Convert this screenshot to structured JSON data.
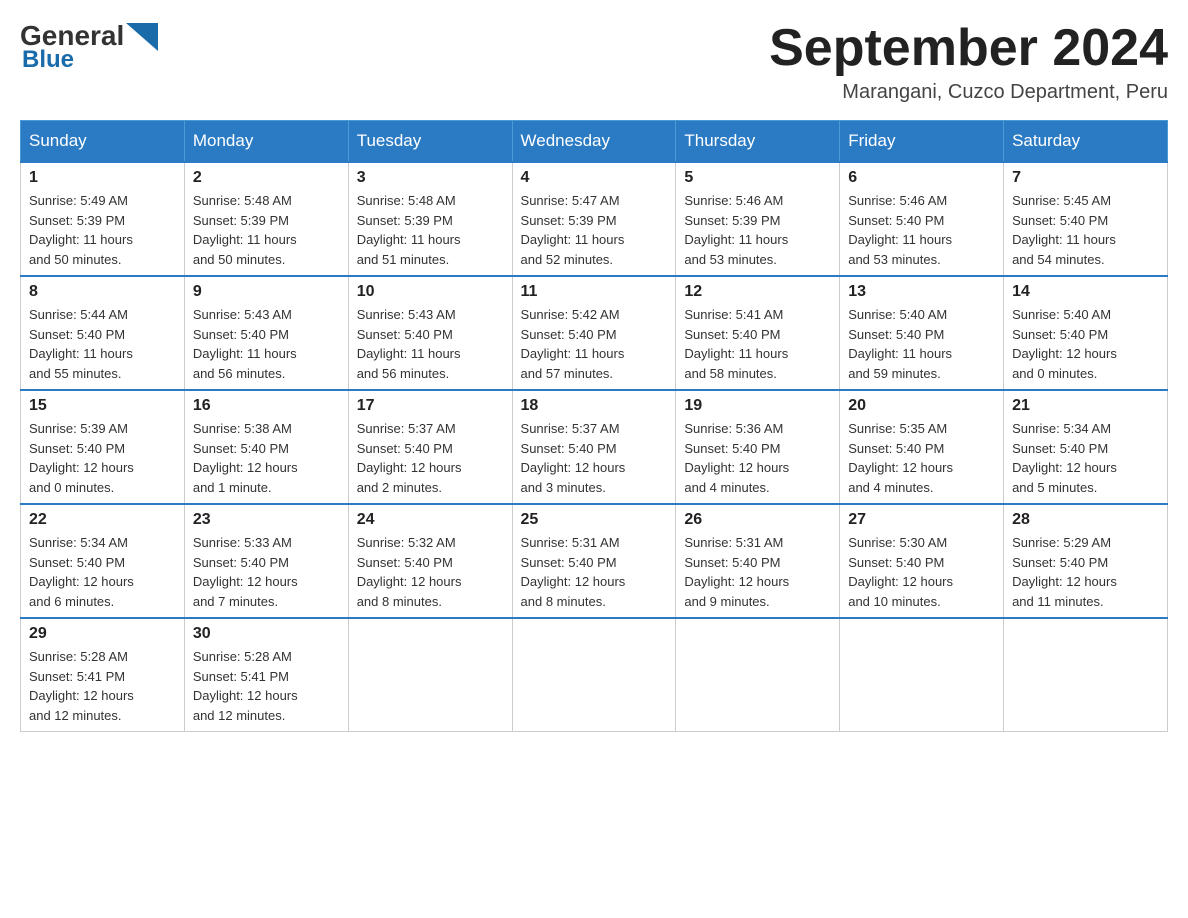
{
  "header": {
    "logo_general": "General",
    "logo_blue": "Blue",
    "month_title": "September 2024",
    "location": "Marangani, Cuzco Department, Peru"
  },
  "days_of_week": [
    "Sunday",
    "Monday",
    "Tuesday",
    "Wednesday",
    "Thursday",
    "Friday",
    "Saturday"
  ],
  "weeks": [
    [
      {
        "day": "1",
        "sunrise": "5:49 AM",
        "sunset": "5:39 PM",
        "daylight": "11 hours and 50 minutes."
      },
      {
        "day": "2",
        "sunrise": "5:48 AM",
        "sunset": "5:39 PM",
        "daylight": "11 hours and 50 minutes."
      },
      {
        "day": "3",
        "sunrise": "5:48 AM",
        "sunset": "5:39 PM",
        "daylight": "11 hours and 51 minutes."
      },
      {
        "day": "4",
        "sunrise": "5:47 AM",
        "sunset": "5:39 PM",
        "daylight": "11 hours and 52 minutes."
      },
      {
        "day": "5",
        "sunrise": "5:46 AM",
        "sunset": "5:39 PM",
        "daylight": "11 hours and 53 minutes."
      },
      {
        "day": "6",
        "sunrise": "5:46 AM",
        "sunset": "5:40 PM",
        "daylight": "11 hours and 53 minutes."
      },
      {
        "day": "7",
        "sunrise": "5:45 AM",
        "sunset": "5:40 PM",
        "daylight": "11 hours and 54 minutes."
      }
    ],
    [
      {
        "day": "8",
        "sunrise": "5:44 AM",
        "sunset": "5:40 PM",
        "daylight": "11 hours and 55 minutes."
      },
      {
        "day": "9",
        "sunrise": "5:43 AM",
        "sunset": "5:40 PM",
        "daylight": "11 hours and 56 minutes."
      },
      {
        "day": "10",
        "sunrise": "5:43 AM",
        "sunset": "5:40 PM",
        "daylight": "11 hours and 56 minutes."
      },
      {
        "day": "11",
        "sunrise": "5:42 AM",
        "sunset": "5:40 PM",
        "daylight": "11 hours and 57 minutes."
      },
      {
        "day": "12",
        "sunrise": "5:41 AM",
        "sunset": "5:40 PM",
        "daylight": "11 hours and 58 minutes."
      },
      {
        "day": "13",
        "sunrise": "5:40 AM",
        "sunset": "5:40 PM",
        "daylight": "11 hours and 59 minutes."
      },
      {
        "day": "14",
        "sunrise": "5:40 AM",
        "sunset": "5:40 PM",
        "daylight": "12 hours and 0 minutes."
      }
    ],
    [
      {
        "day": "15",
        "sunrise": "5:39 AM",
        "sunset": "5:40 PM",
        "daylight": "12 hours and 0 minutes."
      },
      {
        "day": "16",
        "sunrise": "5:38 AM",
        "sunset": "5:40 PM",
        "daylight": "12 hours and 1 minute."
      },
      {
        "day": "17",
        "sunrise": "5:37 AM",
        "sunset": "5:40 PM",
        "daylight": "12 hours and 2 minutes."
      },
      {
        "day": "18",
        "sunrise": "5:37 AM",
        "sunset": "5:40 PM",
        "daylight": "12 hours and 3 minutes."
      },
      {
        "day": "19",
        "sunrise": "5:36 AM",
        "sunset": "5:40 PM",
        "daylight": "12 hours and 4 minutes."
      },
      {
        "day": "20",
        "sunrise": "5:35 AM",
        "sunset": "5:40 PM",
        "daylight": "12 hours and 4 minutes."
      },
      {
        "day": "21",
        "sunrise": "5:34 AM",
        "sunset": "5:40 PM",
        "daylight": "12 hours and 5 minutes."
      }
    ],
    [
      {
        "day": "22",
        "sunrise": "5:34 AM",
        "sunset": "5:40 PM",
        "daylight": "12 hours and 6 minutes."
      },
      {
        "day": "23",
        "sunrise": "5:33 AM",
        "sunset": "5:40 PM",
        "daylight": "12 hours and 7 minutes."
      },
      {
        "day": "24",
        "sunrise": "5:32 AM",
        "sunset": "5:40 PM",
        "daylight": "12 hours and 8 minutes."
      },
      {
        "day": "25",
        "sunrise": "5:31 AM",
        "sunset": "5:40 PM",
        "daylight": "12 hours and 8 minutes."
      },
      {
        "day": "26",
        "sunrise": "5:31 AM",
        "sunset": "5:40 PM",
        "daylight": "12 hours and 9 minutes."
      },
      {
        "day": "27",
        "sunrise": "5:30 AM",
        "sunset": "5:40 PM",
        "daylight": "12 hours and 10 minutes."
      },
      {
        "day": "28",
        "sunrise": "5:29 AM",
        "sunset": "5:40 PM",
        "daylight": "12 hours and 11 minutes."
      }
    ],
    [
      {
        "day": "29",
        "sunrise": "5:28 AM",
        "sunset": "5:41 PM",
        "daylight": "12 hours and 12 minutes."
      },
      {
        "day": "30",
        "sunrise": "5:28 AM",
        "sunset": "5:41 PM",
        "daylight": "12 hours and 12 minutes."
      },
      null,
      null,
      null,
      null,
      null
    ]
  ],
  "labels": {
    "sunrise": "Sunrise:",
    "sunset": "Sunset:",
    "daylight": "Daylight:"
  }
}
